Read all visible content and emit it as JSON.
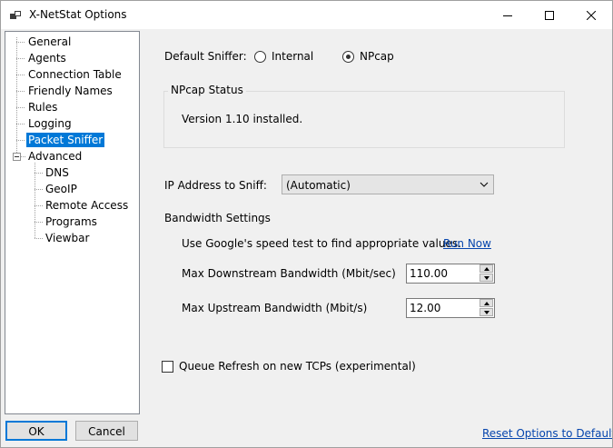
{
  "window": {
    "title": "X-NetStat Options"
  },
  "tree": {
    "items": [
      {
        "label": "General"
      },
      {
        "label": "Agents"
      },
      {
        "label": "Connection Table"
      },
      {
        "label": "Friendly Names"
      },
      {
        "label": "Rules"
      },
      {
        "label": "Logging"
      },
      {
        "label": "Packet Sniffer"
      },
      {
        "label": "Advanced"
      },
      {
        "label": "DNS"
      },
      {
        "label": "GeoIP"
      },
      {
        "label": "Remote Access"
      },
      {
        "label": "Programs"
      },
      {
        "label": "Viewbar"
      }
    ],
    "selected": "Packet Sniffer"
  },
  "sniffer": {
    "label": "Default Sniffer:",
    "options": [
      "Internal",
      "NPcap"
    ],
    "selected": "NPcap"
  },
  "npcap_status": {
    "title": "NPcap Status",
    "text": "Version 1.10 installed."
  },
  "ip_address": {
    "label": "IP Address to Sniff:",
    "value": "(Automatic)"
  },
  "bandwidth": {
    "title": "Bandwidth Settings",
    "hint": "Use Google's speed test to find appropriate values.",
    "run_now": "Run Now",
    "downstream_label": "Max Downstream Bandwidth (Mbit/sec)",
    "downstream_value": "110.00",
    "upstream_label": "Max Upstream Bandwidth (Mbit/s)",
    "upstream_value": "12.00"
  },
  "queue_refresh": {
    "label": "Queue Refresh on new TCPs (experimental)",
    "checked": false
  },
  "buttons": {
    "ok": "OK",
    "cancel": "Cancel",
    "reset": "Reset Options to Default"
  },
  "colors": {
    "accent": "#0078d7",
    "link": "#0645ad"
  }
}
